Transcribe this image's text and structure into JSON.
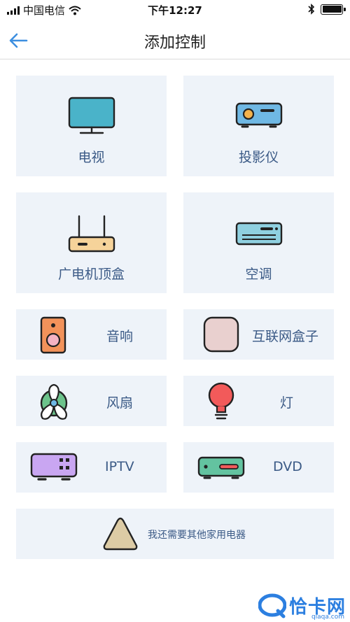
{
  "status_bar": {
    "carrier": "中国电信",
    "time": "下午12:27"
  },
  "nav": {
    "title": "添加控制",
    "back_icon": "arrow-left-icon"
  },
  "devices": [
    {
      "label": "电视",
      "icon": "tv-icon"
    },
    {
      "label": "投影仪",
      "icon": "projector-icon"
    },
    {
      "label": "广电机顶盒",
      "icon": "set-top-box-icon"
    },
    {
      "label": "空调",
      "icon": "air-conditioner-icon"
    },
    {
      "label": "音响",
      "icon": "speaker-icon"
    },
    {
      "label": "互联网盒子",
      "icon": "internet-box-icon"
    },
    {
      "label": "风扇",
      "icon": "fan-icon"
    },
    {
      "label": "灯",
      "icon": "light-bulb-icon"
    },
    {
      "label": "IPTV",
      "icon": "iptv-icon"
    },
    {
      "label": "DVD",
      "icon": "dvd-icon"
    }
  ],
  "other": {
    "label": "我还需要其他家用电器",
    "icon": "triangle-icon"
  },
  "watermark": {
    "text": "恰卡网",
    "sub": "qiaqa.com"
  },
  "colors": {
    "card_bg": "#eef3f9",
    "label": "#3b5a86",
    "accent": "#3d8fe0"
  }
}
